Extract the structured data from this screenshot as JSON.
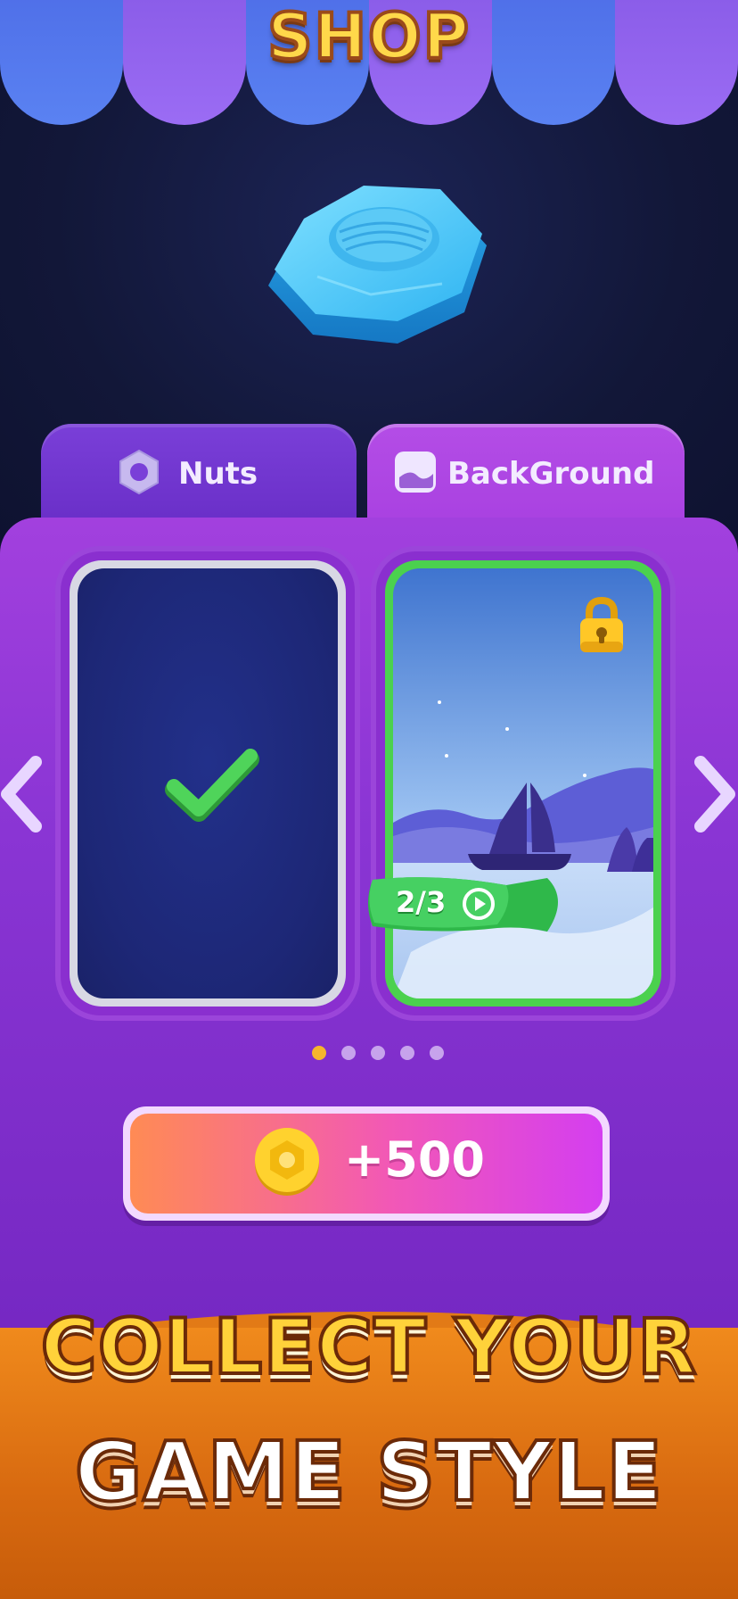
{
  "header": {
    "title": "SHOP"
  },
  "tabs": [
    {
      "label": "Nuts",
      "icon": "hex-nut-icon",
      "selected": false
    },
    {
      "label": "BackGround",
      "icon": "landscape-icon",
      "selected": true
    }
  ],
  "cards": [
    {
      "status": "selected",
      "icon": "checkmark-icon"
    },
    {
      "status": "locked",
      "icon": "lock-icon",
      "progress_label": "2/3",
      "progress_icon": "play-video-icon"
    }
  ],
  "pagination": {
    "count": 5,
    "active_index": 0
  },
  "purchase": {
    "label": "+500",
    "icon": "gold-nut-coin-icon"
  },
  "banner": {
    "line1": "COLLECT YOUR",
    "line2": "GAME STYLE"
  },
  "colors": {
    "panel": "#9a3bdc",
    "accent": "#f6b52c",
    "card_border_selected": "#d8d8e4",
    "card_border_active": "#4bd14e",
    "banner": "#e27a16"
  }
}
